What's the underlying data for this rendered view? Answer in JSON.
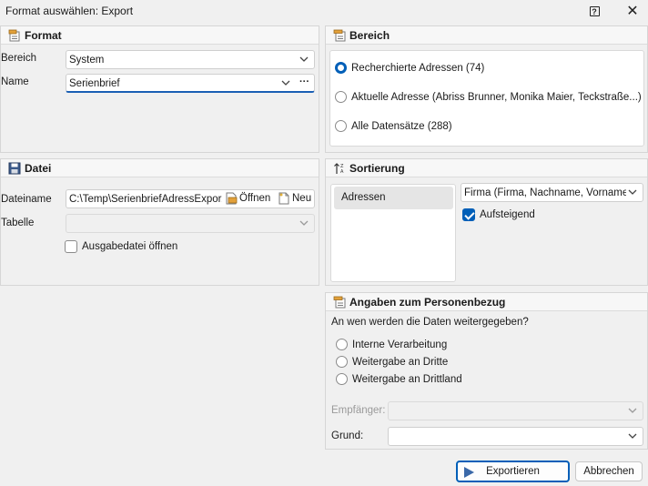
{
  "window": {
    "title": "Format auswählen: Export",
    "help_glyph": "?",
    "close_glyph": "✕"
  },
  "format": {
    "header": "Format",
    "bereich_label": "Bereich",
    "bereich_value": "System",
    "name_label": "Name",
    "name_value": "Serienbrief",
    "more_glyph": "···"
  },
  "bereich": {
    "header": "Bereich",
    "options": [
      {
        "label": "Recherchierte Adressen (74)",
        "checked": true
      },
      {
        "label": "Aktuelle Adresse (Abriss Brunner, Monika Maier, Teckstraße...)",
        "checked": false
      },
      {
        "label": "Alle Datensätze (288)",
        "checked": false
      }
    ]
  },
  "datei": {
    "header": "Datei",
    "dateiname_label": "Dateiname",
    "dateiname_value": "C:\\Temp\\SerienbriefAdressExpor...",
    "open_label": "Öffnen",
    "new_label": "Neu",
    "tabelle_label": "Tabelle",
    "tabelle_value": "",
    "ausgabe_label": "Ausgabedatei öffnen",
    "ausgabe_checked": false
  },
  "sortierung": {
    "header": "Sortierung",
    "list_items": [
      "Adressen"
    ],
    "sort_value": "Firma (Firma, Nachname, Vorname...",
    "ascending_label": "Aufsteigend",
    "ascending_checked": true
  },
  "personenbezug": {
    "header": "Angaben zum Personenbezug",
    "question": "An wen werden die Daten weitergegeben?",
    "options": [
      {
        "label": "Interne Verarbeitung",
        "checked": false
      },
      {
        "label": "Weitergabe an Dritte",
        "checked": false
      },
      {
        "label": "Weitergabe an Drittland",
        "checked": false
      }
    ],
    "empfaenger_label": "Empfänger:",
    "empfaenger_value": "",
    "grund_label": "Grund:",
    "grund_value": ""
  },
  "buttons": {
    "export_label": "Exportieren",
    "cancel_label": "Abbrechen"
  },
  "colors": {
    "accent": "#005fb8",
    "background": "#f0f0f0"
  }
}
